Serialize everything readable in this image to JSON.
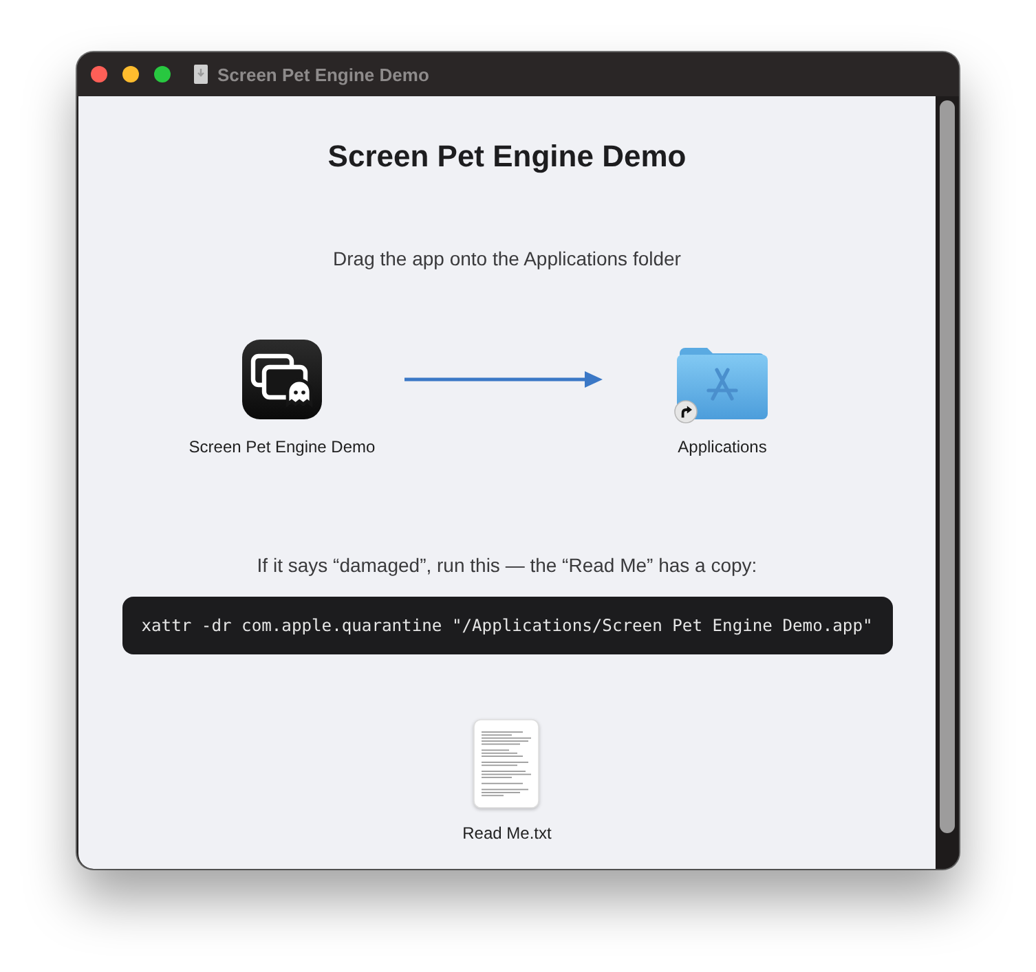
{
  "window": {
    "title": "Screen Pet Engine Demo"
  },
  "heading": "Screen Pet Engine Demo",
  "instruction": "Drag the app onto the Applications folder",
  "items": [
    {
      "kind": "app",
      "label": "Screen Pet Engine Demo"
    },
    {
      "kind": "folder",
      "label": "Applications"
    }
  ],
  "note": "If it says “damaged”, run this — the “Read Me” has a copy:",
  "command": "xattr -dr com.apple.quarantine \"/Applications/Screen Pet Engine Demo.app\"",
  "file": {
    "label": "Read Me.txt"
  }
}
